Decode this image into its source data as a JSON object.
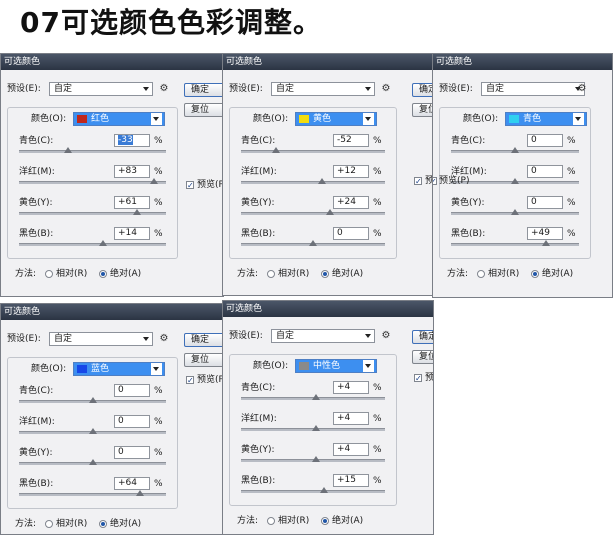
{
  "title": "07可选颜色色彩调整。",
  "labels": {
    "dialog_title": "可选颜色",
    "preset": "预设(E):",
    "colors": "颜色(O):",
    "cyan": "青色(C):",
    "magenta": "洋红(M):",
    "yellow": "黄色(Y):",
    "black": "黑色(B):",
    "method": "方法:",
    "relative": "相对(R)",
    "absolute": "绝对(A)",
    "ok": "确定",
    "reset": "复位",
    "preview": "预览(P)",
    "percent": "%"
  },
  "colors": {
    "slider_track": "#b8bcc4",
    "titlebar": "#2b3443",
    "color_select": "#3d8ff0"
  },
  "dialogs": [
    {
      "preset": "自定",
      "color_name": "红色",
      "swatch": "#c0271c",
      "values": [
        "-33",
        "+83",
        "+61",
        "+14"
      ],
      "slider": [
        -33,
        83,
        61,
        14
      ],
      "cyan_selected": true,
      "method": "absolute"
    },
    {
      "preset": "自定",
      "color_name": "黄色",
      "swatch": "#f2dc0f",
      "values": [
        "-52",
        "+12",
        "+24",
        "0"
      ],
      "slider": [
        -52,
        12,
        24,
        0
      ],
      "cyan_selected": false,
      "method": "absolute"
    },
    {
      "preset": "自定",
      "color_name": "青色",
      "swatch": "#2fd0ef",
      "values": [
        "0",
        "0",
        "0",
        "+49"
      ],
      "slider": [
        0,
        0,
        0,
        49
      ],
      "cyan_selected": false,
      "method": "absolute"
    },
    {
      "preset": "自定",
      "color_name": "蓝色",
      "swatch": "#1747e8",
      "values": [
        "0",
        "0",
        "0",
        "+64"
      ],
      "slider": [
        0,
        0,
        0,
        64
      ],
      "cyan_selected": false,
      "method": "absolute"
    },
    {
      "preset": "自定",
      "color_name": "中性色",
      "swatch": "#8a8a8a",
      "values": [
        "+4",
        "+4",
        "+4",
        "+15"
      ],
      "slider": [
        4,
        4,
        4,
        15
      ],
      "cyan_selected": false,
      "method": "absolute"
    }
  ]
}
